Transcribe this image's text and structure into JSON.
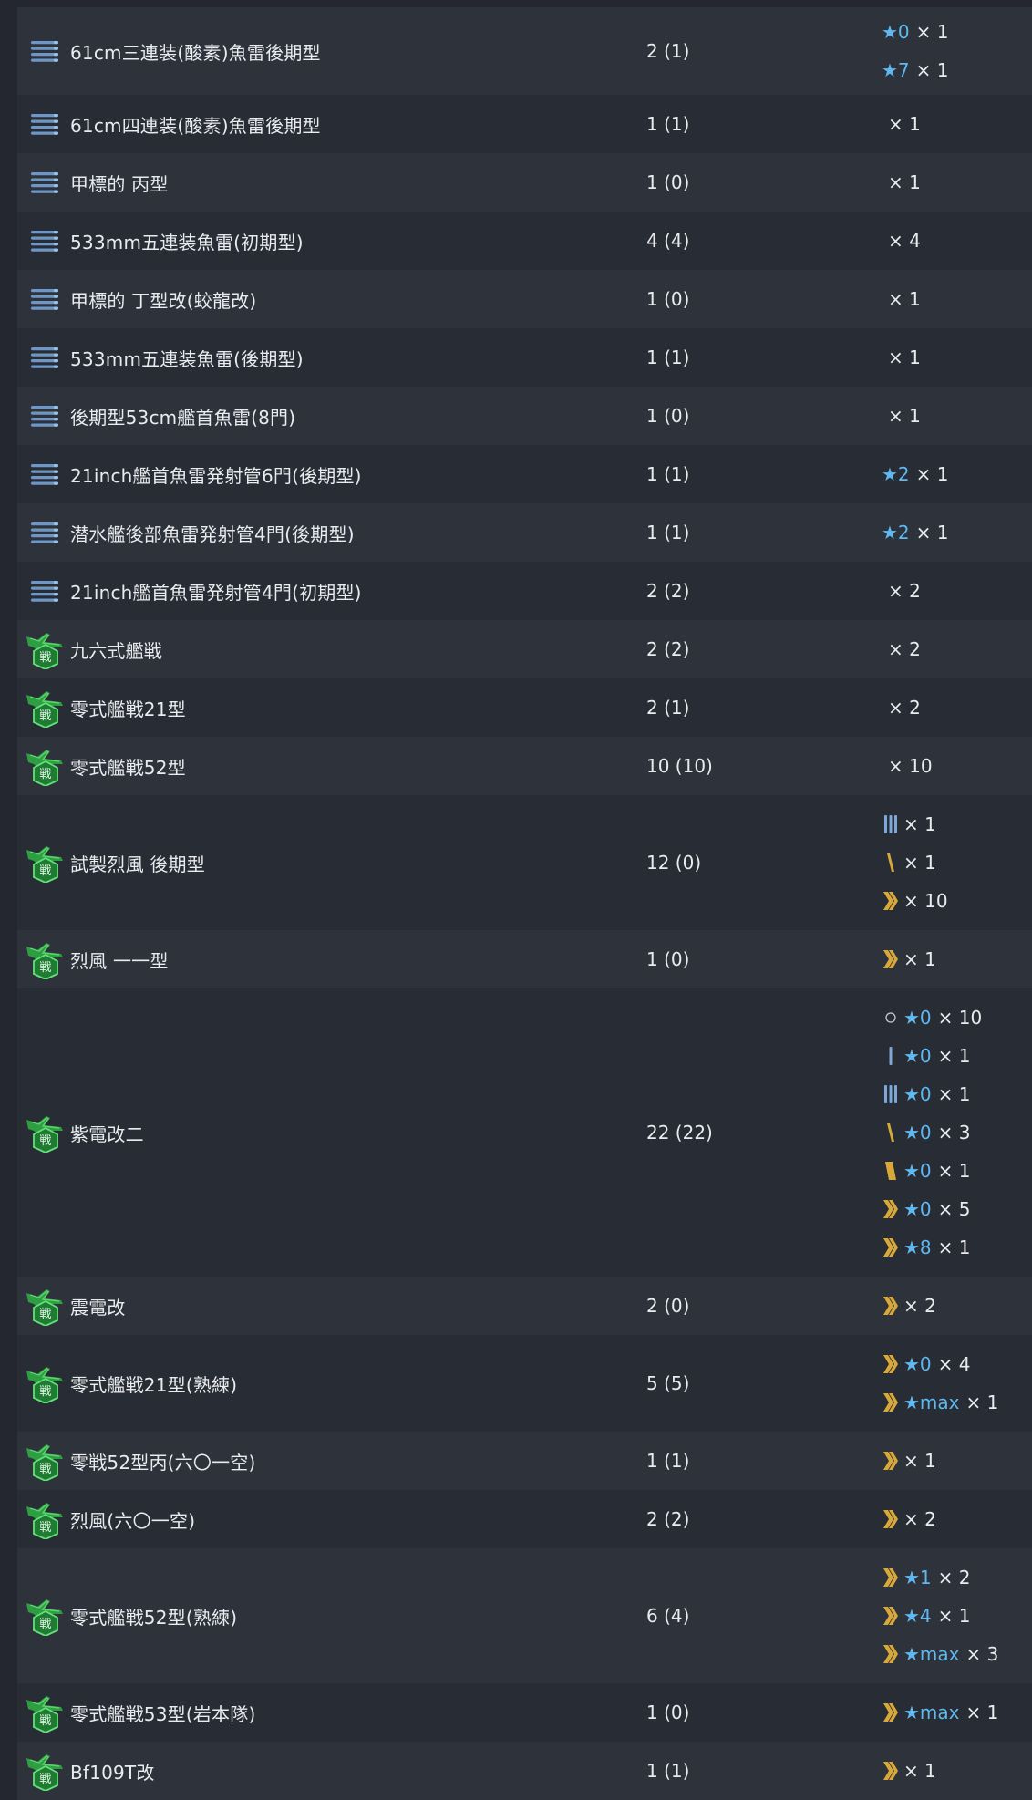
{
  "rows": [
    {
      "name": "61cm三連装(酸素)魚雷後期型",
      "icon": "torpedo-icon",
      "count": "2 (1)",
      "prof": [
        {
          "icon": "",
          "star": "★0",
          "mult": "× 1"
        },
        {
          "icon": "",
          "star": "★7",
          "mult": "× 1"
        }
      ]
    },
    {
      "name": "61cm四連装(酸素)魚雷後期型",
      "icon": "torpedo-icon",
      "count": "1 (1)",
      "prof": [
        {
          "icon": "",
          "star": "",
          "mult": "× 1"
        }
      ]
    },
    {
      "name": "甲標的 丙型",
      "icon": "torpedo-icon",
      "count": "1 (0)",
      "prof": [
        {
          "icon": "",
          "star": "",
          "mult": "× 1"
        }
      ]
    },
    {
      "name": "533mm五連装魚雷(初期型)",
      "icon": "torpedo-icon",
      "count": "4 (4)",
      "prof": [
        {
          "icon": "",
          "star": "",
          "mult": "× 4"
        }
      ]
    },
    {
      "name": "甲標的 丁型改(蛟龍改)",
      "icon": "torpedo-icon",
      "count": "1 (0)",
      "prof": [
        {
          "icon": "",
          "star": "",
          "mult": "× 1"
        }
      ]
    },
    {
      "name": "533mm五連装魚雷(後期型)",
      "icon": "torpedo-icon",
      "count": "1 (1)",
      "prof": [
        {
          "icon": "",
          "star": "",
          "mult": "× 1"
        }
      ]
    },
    {
      "name": "後期型53cm艦首魚雷(8門)",
      "icon": "torpedo-icon",
      "count": "1 (0)",
      "prof": [
        {
          "icon": "",
          "star": "",
          "mult": "× 1"
        }
      ]
    },
    {
      "name": "21inch艦首魚雷発射管6門(後期型)",
      "icon": "torpedo-icon",
      "count": "1 (1)",
      "prof": [
        {
          "icon": "",
          "star": "★2",
          "mult": "× 1"
        }
      ]
    },
    {
      "name": "潜水艦後部魚雷発射管4門(後期型)",
      "icon": "torpedo-icon",
      "count": "1 (1)",
      "prof": [
        {
          "icon": "",
          "star": "★2",
          "mult": "× 1"
        }
      ]
    },
    {
      "name": "21inch艦首魚雷発射管4門(初期型)",
      "icon": "torpedo-icon",
      "count": "2 (2)",
      "prof": [
        {
          "icon": "",
          "star": "",
          "mult": "× 2"
        }
      ]
    },
    {
      "name": "九六式艦戦",
      "icon": "fighter-icon",
      "count": "2 (2)",
      "prof": [
        {
          "icon": "",
          "star": "",
          "mult": "× 2"
        }
      ]
    },
    {
      "name": "零式艦戦21型",
      "icon": "fighter-icon",
      "count": "2 (1)",
      "prof": [
        {
          "icon": "",
          "star": "",
          "mult": "× 2"
        }
      ]
    },
    {
      "name": "零式艦戦52型",
      "icon": "fighter-icon",
      "count": "10 (10)",
      "prof": [
        {
          "icon": "",
          "star": "",
          "mult": "× 10"
        }
      ]
    },
    {
      "name": "試製烈風 後期型",
      "icon": "fighter-icon",
      "count": "12 (0)",
      "prof": [
        {
          "icon": "prof-3-icon",
          "star": "",
          "mult": "× 1"
        },
        {
          "icon": "prof-4-icon",
          "star": "",
          "mult": "× 1"
        },
        {
          "icon": "prof-7-icon",
          "star": "",
          "mult": "× 10"
        }
      ]
    },
    {
      "name": "烈風 一一型",
      "icon": "fighter-icon",
      "count": "1 (0)",
      "prof": [
        {
          "icon": "prof-7-icon",
          "star": "",
          "mult": "× 1"
        }
      ]
    },
    {
      "name": "紫電改二",
      "icon": "fighter-icon",
      "count": "22 (22)",
      "prof": [
        {
          "icon": "prof-0-icon",
          "star": "★0",
          "mult": "× 10"
        },
        {
          "icon": "prof-1-icon",
          "star": "★0",
          "mult": "× 1"
        },
        {
          "icon": "prof-3-icon",
          "star": "★0",
          "mult": "× 1"
        },
        {
          "icon": "prof-4-icon",
          "star": "★0",
          "mult": "× 3"
        },
        {
          "icon": "prof-6-icon",
          "star": "★0",
          "mult": "× 1"
        },
        {
          "icon": "prof-7-icon",
          "star": "★0",
          "mult": "× 5"
        },
        {
          "icon": "prof-7-icon",
          "star": "★8",
          "mult": "× 1"
        }
      ]
    },
    {
      "name": "震電改",
      "icon": "fighter-icon",
      "count": "2 (0)",
      "prof": [
        {
          "icon": "prof-7-icon",
          "star": "",
          "mult": "× 2"
        }
      ]
    },
    {
      "name": "零式艦戦21型(熟練)",
      "icon": "fighter-icon",
      "count": "5 (5)",
      "prof": [
        {
          "icon": "prof-7-icon",
          "star": "★0",
          "mult": "× 4"
        },
        {
          "icon": "prof-7-icon",
          "star": "★max",
          "mult": "× 1"
        }
      ]
    },
    {
      "name": "零戦52型丙(六〇一空)",
      "icon": "fighter-icon",
      "count": "1 (1)",
      "prof": [
        {
          "icon": "prof-7-icon",
          "star": "",
          "mult": "× 1"
        }
      ]
    },
    {
      "name": "烈風(六〇一空)",
      "icon": "fighter-icon",
      "count": "2 (2)",
      "prof": [
        {
          "icon": "prof-7-icon",
          "star": "",
          "mult": "× 2"
        }
      ]
    },
    {
      "name": "零式艦戦52型(熟練)",
      "icon": "fighter-icon",
      "count": "6 (4)",
      "prof": [
        {
          "icon": "prof-7-icon",
          "star": "★1",
          "mult": "× 2"
        },
        {
          "icon": "prof-7-icon",
          "star": "★4",
          "mult": "× 1"
        },
        {
          "icon": "prof-7-icon",
          "star": "★max",
          "mult": "× 3"
        }
      ]
    },
    {
      "name": "零式艦戦53型(岩本隊)",
      "icon": "fighter-icon",
      "count": "1 (0)",
      "prof": [
        {
          "icon": "prof-7-icon",
          "star": "★max",
          "mult": "× 1"
        }
      ]
    },
    {
      "name": "Bf109T改",
      "icon": "fighter-icon",
      "count": "1 (1)",
      "prof": [
        {
          "icon": "prof-7-icon",
          "star": "",
          "mult": "× 1"
        }
      ]
    }
  ]
}
